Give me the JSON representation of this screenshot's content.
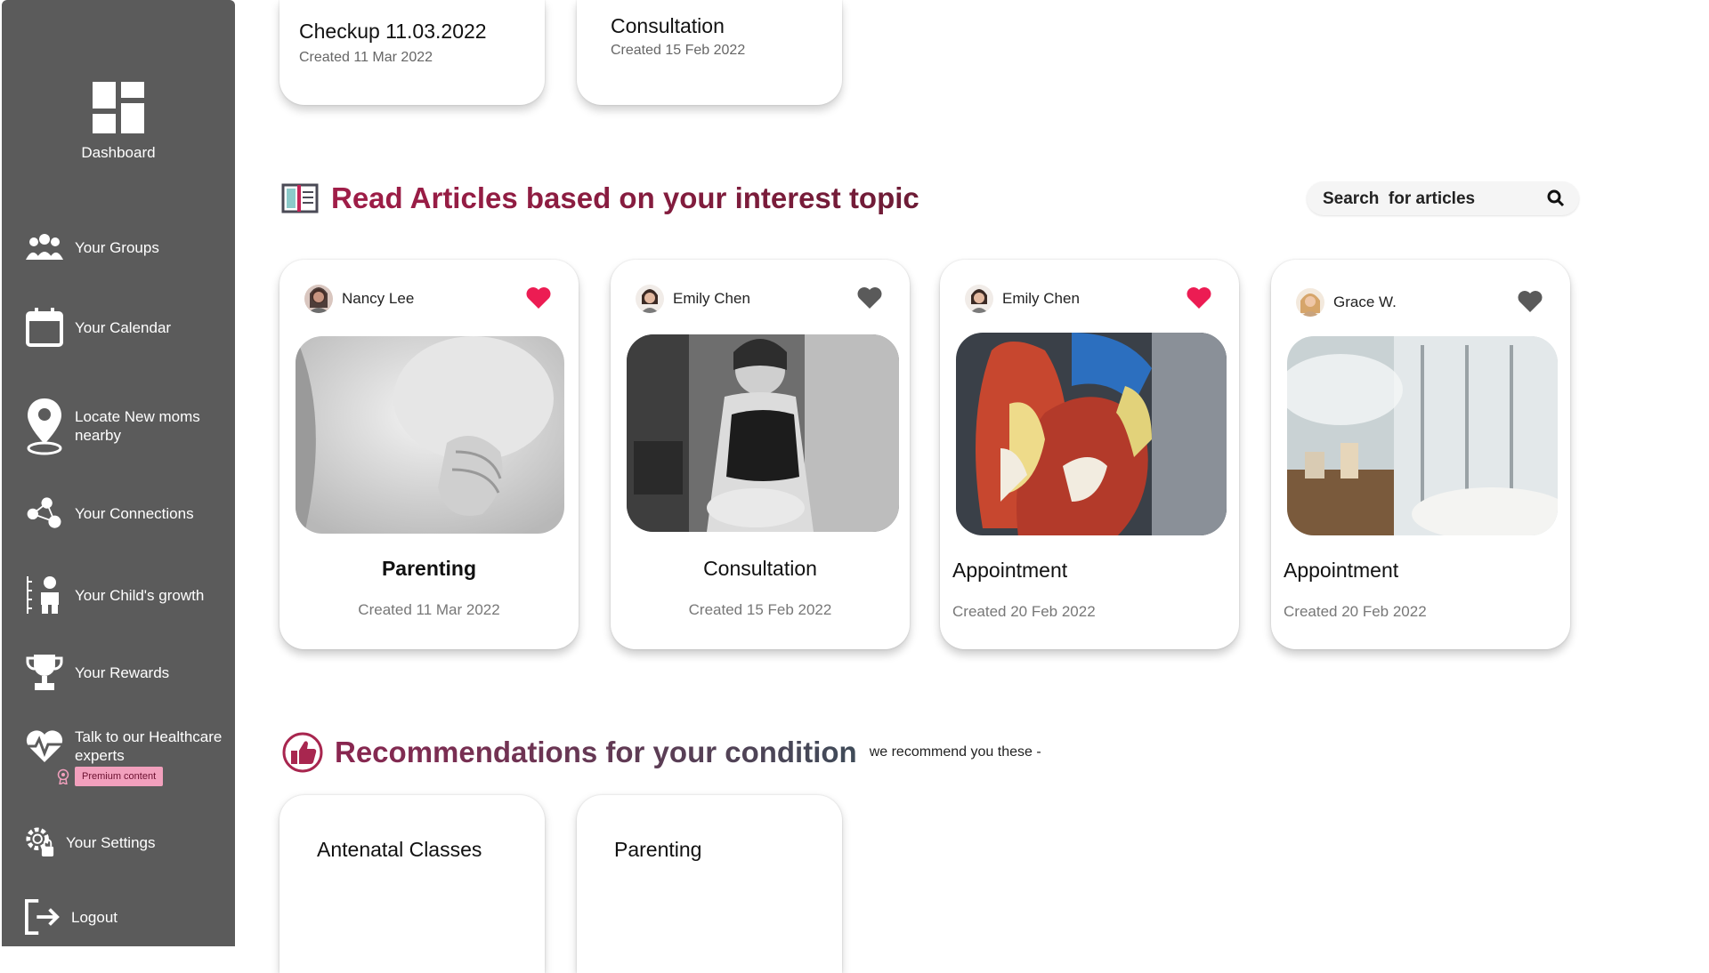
{
  "sidebar": {
    "dashboard_label": "Dashboard",
    "items": [
      {
        "label": "Your Groups",
        "icon": "groups-icon"
      },
      {
        "label": "Your Calendar",
        "icon": "calendar-icon"
      },
      {
        "label": "Locate New moms nearby",
        "icon": "location-pin-icon"
      },
      {
        "label": "Your Connections",
        "icon": "connections-icon"
      },
      {
        "label": "Your Child's growth",
        "icon": "child-growth-icon"
      },
      {
        "label": "Your Rewards",
        "icon": "trophy-icon"
      },
      {
        "label": "Talk to our Healthcare experts",
        "icon": "heart-pulse-icon"
      },
      {
        "label": "Your  Settings",
        "icon": "settings-icon"
      },
      {
        "label": "Logout",
        "icon": "logout-icon"
      }
    ],
    "premium_label": "Premium content"
  },
  "top_cards": [
    {
      "title": "Checkup 11.03.2022",
      "subtitle": "Created 11 Mar 2022"
    },
    {
      "title": "Consultation",
      "subtitle": "Created 15 Feb 2022"
    }
  ],
  "articles": {
    "title": "Read Articles based on your interest topic",
    "search_placeholder": "Search  for articles",
    "cards": [
      {
        "author": "Nancy Lee",
        "liked": true,
        "title": "Parenting",
        "date": "Created 11 Mar 2022"
      },
      {
        "author": "Emily Chen",
        "liked": false,
        "title": "Consultation",
        "date": "Created 15 Feb 2022"
      },
      {
        "author": "Emily Chen",
        "liked": true,
        "title": "Appointment",
        "date": "Created 20 Feb 2022"
      },
      {
        "author": "Grace W.",
        "liked": false,
        "title": "Appointment",
        "date": "Created 20 Feb 2022"
      }
    ]
  },
  "recommendations": {
    "title": "Recommendations for your condition",
    "subtitle": "we recommend you these -",
    "cards": [
      {
        "title": "Antenatal Classes"
      },
      {
        "title": "Parenting"
      }
    ]
  },
  "colors": {
    "sidebar_bg": "#5b5b5b",
    "heart_liked": "#ec1c53",
    "heart_unliked": "#5a5a5a",
    "articles_title": "#a01d48",
    "premium_tag": "#f2a0bd"
  }
}
